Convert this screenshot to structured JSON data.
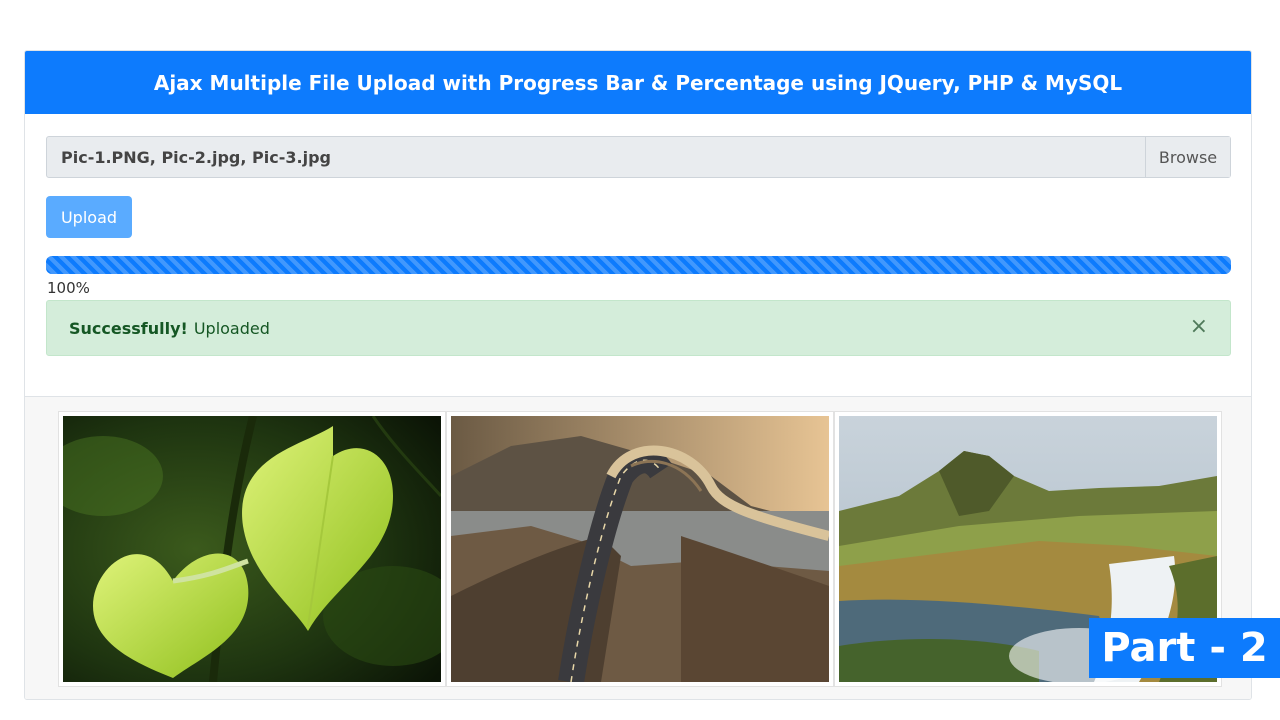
{
  "header": {
    "title": "Ajax Multiple File Upload with Progress Bar & Percentage using JQuery, PHP & MySQL"
  },
  "file_input": {
    "value": "Pic-1.PNG, Pic-2.jpg, Pic-3.jpg",
    "browse_label": "Browse"
  },
  "upload_button": {
    "label": "Upload"
  },
  "progress": {
    "percent_label": "100%",
    "value": 1.0
  },
  "alert": {
    "strong": "Successfully!",
    "text": "Uploaded",
    "close": "×"
  },
  "gallery": {
    "images": [
      {
        "subject": "green-leaves-photo"
      },
      {
        "subject": "curved-bridge-photo"
      },
      {
        "subject": "mountain-waterfall-photo"
      }
    ]
  },
  "badge": {
    "label": "Part - 2"
  },
  "colors": {
    "primary": "#0d7bfd",
    "upload_button": "#5aabff",
    "alert_bg": "#d4edda",
    "alert_text": "#155724"
  }
}
